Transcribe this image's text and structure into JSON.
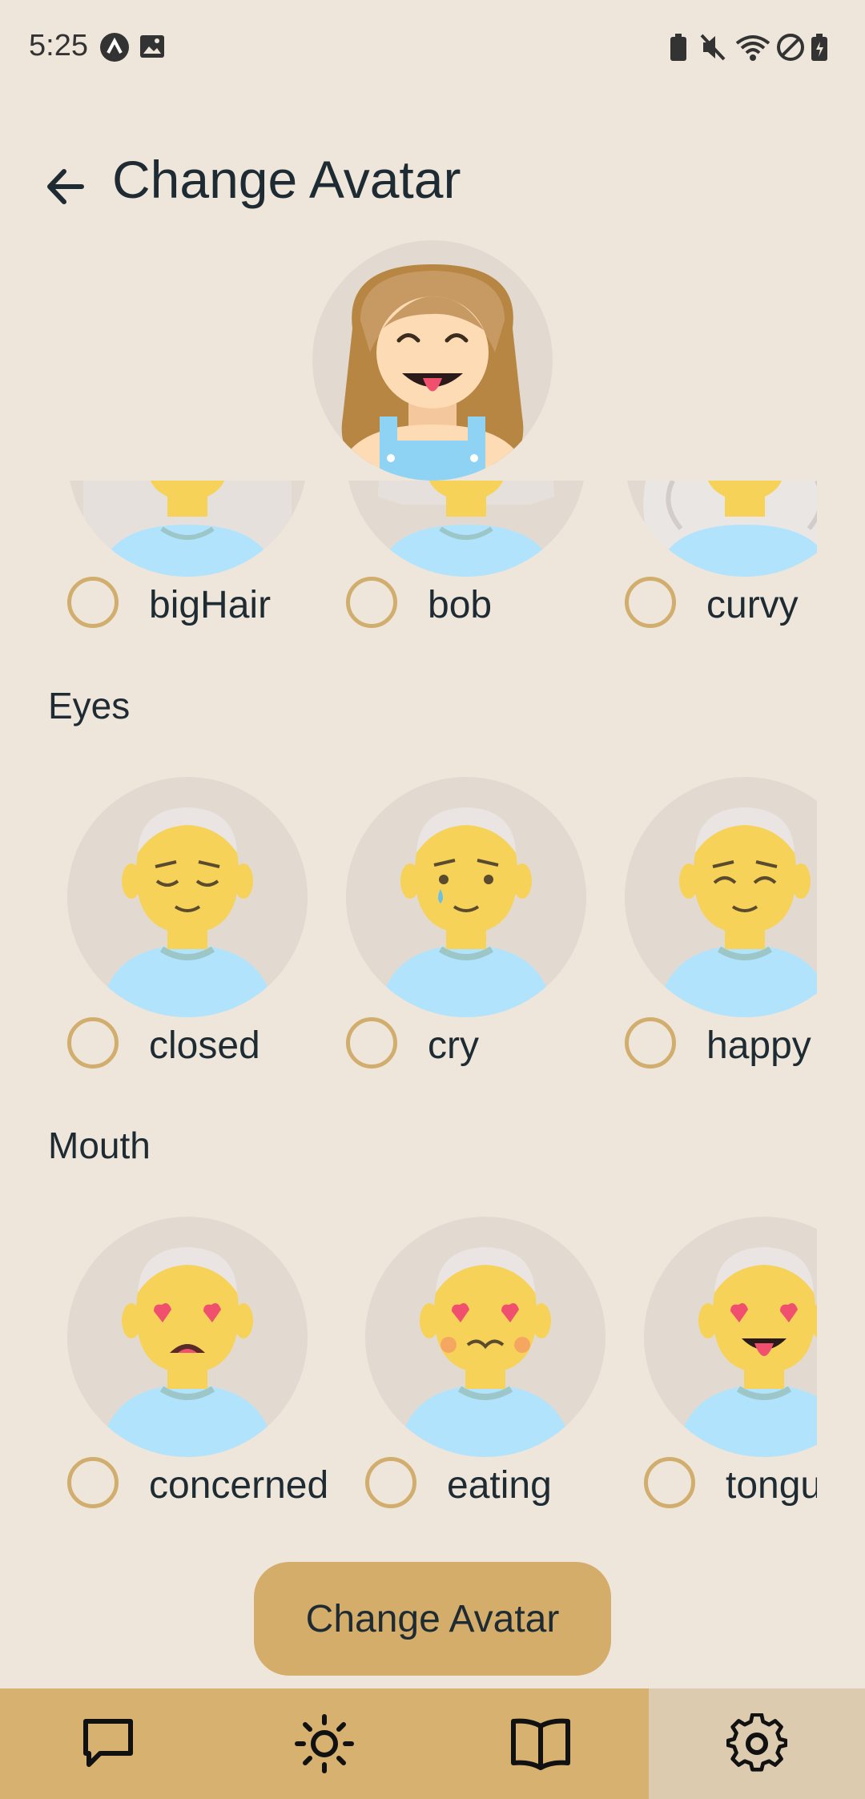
{
  "status_bar": {
    "time": "5:25"
  },
  "header": {
    "title": "Change Avatar"
  },
  "hair_section": {
    "options": [
      {
        "label": "bigHair"
      },
      {
        "label": "bob"
      },
      {
        "label": "curvy"
      }
    ]
  },
  "eyes_section": {
    "title": "Eyes",
    "options": [
      {
        "label": "closed"
      },
      {
        "label": "cry"
      },
      {
        "label": "happy"
      }
    ]
  },
  "mouth_section": {
    "title": "Mouth",
    "options": [
      {
        "label": "concerned"
      },
      {
        "label": "eating"
      },
      {
        "label": "tongue"
      }
    ]
  },
  "action_button": {
    "label": "Change Avatar"
  },
  "bottom_nav": {
    "items": [
      {
        "icon": "chat-icon",
        "active": false
      },
      {
        "icon": "sun-icon",
        "active": false
      },
      {
        "icon": "book-icon",
        "active": false
      },
      {
        "icon": "gear-icon",
        "active": true
      }
    ]
  },
  "colors": {
    "background": "#EEE6DB",
    "accent": "#D4AD6B",
    "nav_active": "#DDCBAF",
    "text": "#1F2B33"
  }
}
